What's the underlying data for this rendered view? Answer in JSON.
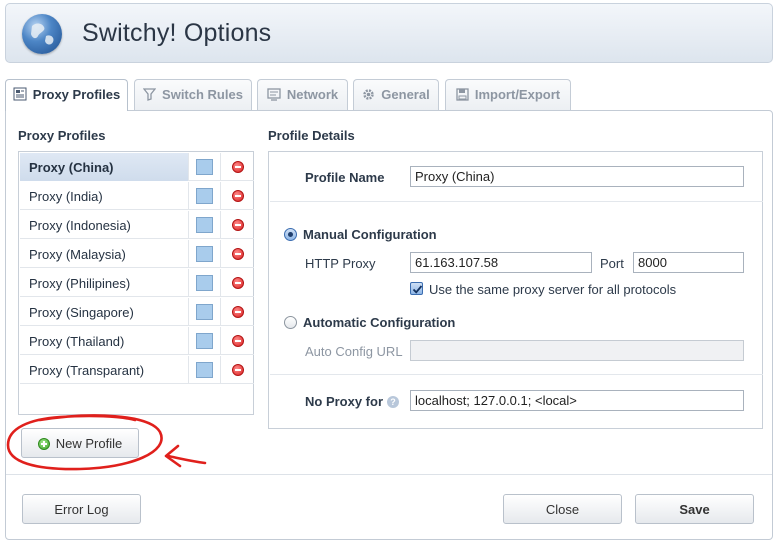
{
  "app": {
    "title": "Switchy! Options",
    "logo_icon": "globe-icon"
  },
  "tabs": [
    {
      "label": "Proxy Profiles",
      "icon": "profile-icon",
      "active": true
    },
    {
      "label": "Switch Rules",
      "icon": "filter-icon",
      "active": false
    },
    {
      "label": "Network",
      "icon": "network-icon",
      "active": false
    },
    {
      "label": "General",
      "icon": "gear-icon",
      "active": false
    },
    {
      "label": "Import/Export",
      "icon": "save-icon",
      "active": false
    }
  ],
  "profiles": {
    "heading": "Proxy Profiles",
    "items": [
      {
        "name": "Proxy (China)",
        "selected": true
      },
      {
        "name": "Proxy (India)"
      },
      {
        "name": "Proxy (Indonesia)"
      },
      {
        "name": "Proxy (Malaysia)"
      },
      {
        "name": "Proxy (Philipines)"
      },
      {
        "name": "Proxy (Singapore)"
      },
      {
        "name": "Proxy (Thailand)"
      },
      {
        "name": "Proxy (Transparant)"
      }
    ],
    "new_button": "New Profile"
  },
  "details": {
    "heading": "Profile Details",
    "profile_name_label": "Profile Name",
    "profile_name_value": "Proxy (China)",
    "manual_label": "Manual Configuration",
    "manual_selected": true,
    "http_proxy_label": "HTTP Proxy",
    "http_proxy_value": "61.163.107.58",
    "port_label": "Port",
    "port_value": "8000",
    "same_proxy_label": "Use the same proxy server for all protocols",
    "same_proxy_checked": true,
    "auto_label": "Automatic Configuration",
    "auto_config_url_label": "Auto Config URL",
    "auto_config_url_value": "",
    "no_proxy_label": "No Proxy for",
    "no_proxy_help": "?",
    "no_proxy_value": "localhost; 127.0.0.1; <local>"
  },
  "footer": {
    "error_log": "Error Log",
    "close": "Close",
    "save": "Save"
  },
  "colors": {
    "profile_color": "#a9ccec",
    "annotation": "#e0201c"
  }
}
